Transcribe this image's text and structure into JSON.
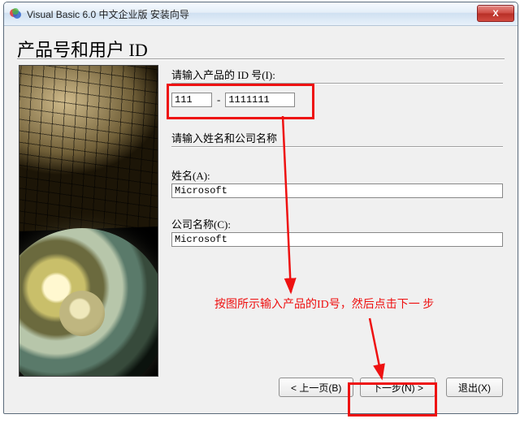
{
  "window": {
    "title": "Visual Basic 6.0 中文企业版 安装向导",
    "close_label": "X"
  },
  "heading": "产品号和用户 ID",
  "labels": {
    "enter_id": "请输入产品的 ID 号(I):",
    "enter_name_company": "请输入姓名和公司名称",
    "name": "姓名(A):",
    "company": "公司名称(C):"
  },
  "inputs": {
    "id1": "111",
    "id2": "1111111",
    "name": "Microsoft",
    "company": "Microsoft"
  },
  "buttons": {
    "back": "< 上一页(B)",
    "next": "下一步(N) >",
    "exit": "退出(X)"
  },
  "annotation": {
    "text": "按图所示输入产品的ID号，然后点击下一 步",
    "color": "#e11"
  }
}
